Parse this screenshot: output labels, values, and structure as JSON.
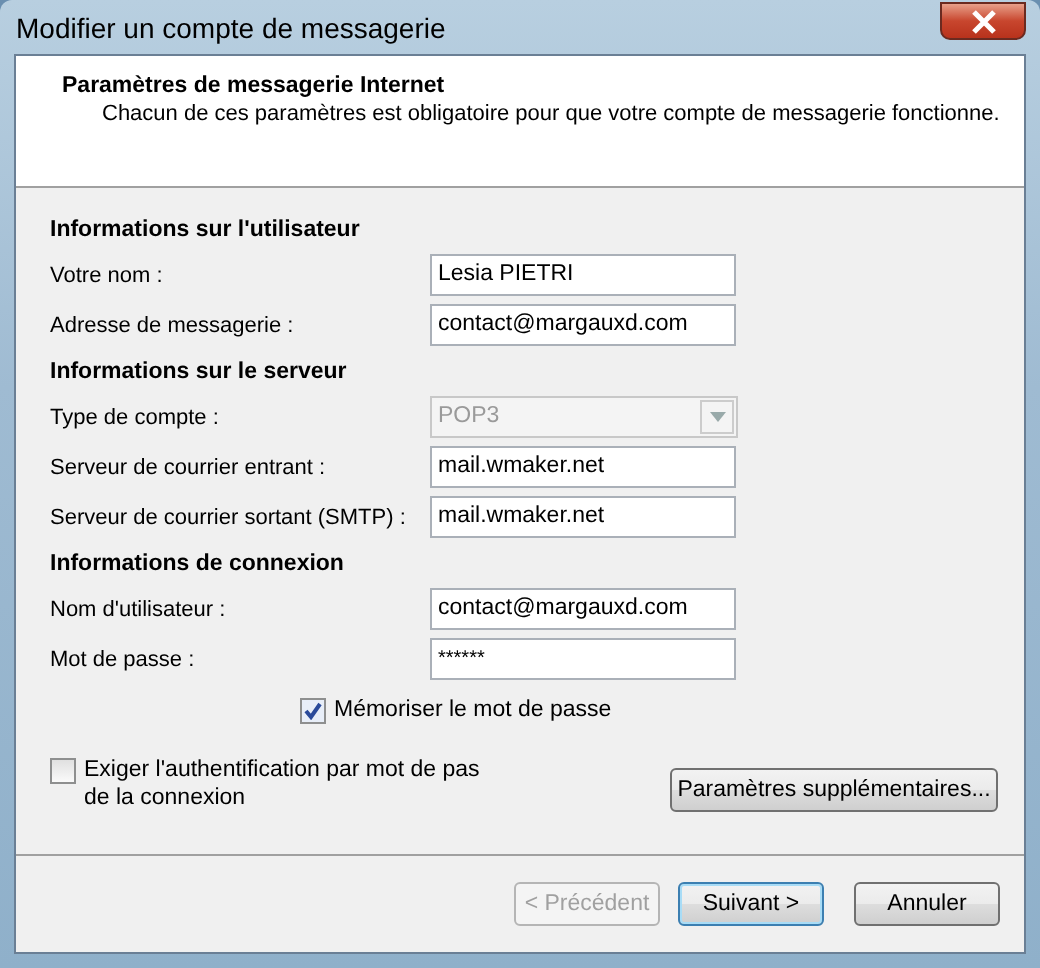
{
  "window": {
    "title": "Modifier un compte de messagerie"
  },
  "header": {
    "title": "Paramètres de messagerie Internet",
    "description": "Chacun de ces paramètres est obligatoire pour que votre compte de messagerie fonctionne."
  },
  "sections": [
    {
      "heading": "Informations sur l'utilisateur",
      "fields": [
        {
          "label": "Votre nom :",
          "kind": "text",
          "value": "Lesia PIETRI",
          "disabled": false
        },
        {
          "label": "Adresse de messagerie :",
          "kind": "text",
          "value": "contact@margauxd.com",
          "disabled": false
        }
      ]
    },
    {
      "heading": "Informations sur le serveur",
      "fields": [
        {
          "label": "Type de compte :",
          "kind": "dropdown",
          "value": "POP3",
          "disabled": true
        },
        {
          "label": "Serveur de courrier entrant :",
          "kind": "text",
          "value": "mail.wmaker.net",
          "disabled": false
        },
        {
          "label": "Serveur de courrier sortant (SMTP) :",
          "kind": "text",
          "value": "mail.wmaker.net",
          "disabled": false
        }
      ]
    },
    {
      "heading": "Informations de connexion",
      "fields": [
        {
          "label": "Nom d'utilisateur :",
          "kind": "text",
          "value": "contact@margauxd.com",
          "disabled": false
        },
        {
          "label": "Mot de passe :",
          "kind": "password",
          "value": "******",
          "disabled": false
        }
      ]
    }
  ],
  "remember_password": {
    "label": "Mémoriser le mot de passe",
    "checked": true
  },
  "require_auth": {
    "label": "Exiger l'authentification par mot de pas de la connexion",
    "checked": false
  },
  "more_settings_button": {
    "label": "Paramètres supplémentaires..."
  },
  "buttons": [
    {
      "label": "< Précédent",
      "disabled": true,
      "default": false
    },
    {
      "label": "Suivant >",
      "disabled": false,
      "default": true
    },
    {
      "label": "Annuler",
      "disabled": false,
      "default": false
    }
  ]
}
